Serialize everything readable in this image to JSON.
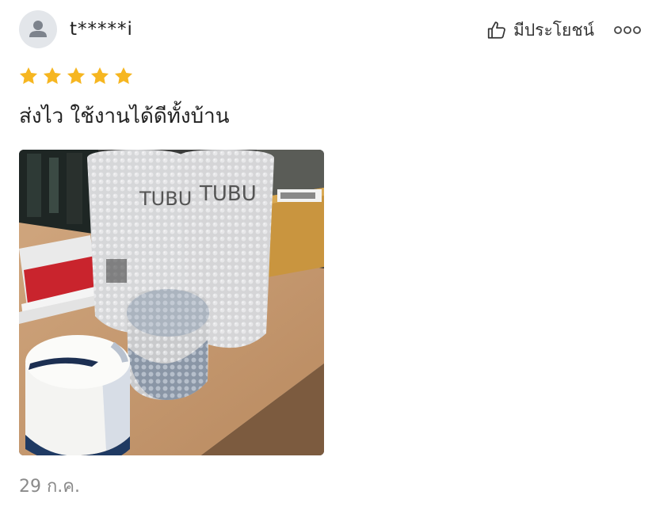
{
  "review": {
    "username": "t*****i",
    "rating": 5,
    "rating_max": 5,
    "text": "ส่งไว ใช้งานได้ดีทั้งบ้าน",
    "date": "29 ก.ค."
  },
  "actions": {
    "helpful_label": "มีประโยชน์",
    "helpful_icon": "thumbs-up-icon",
    "more_icon": "more-dots-icon"
  },
  "photo": {
    "bottle_brand": "TUBU"
  },
  "colors": {
    "star": "#F6B620",
    "avatar_bg": "#E3E6EA",
    "date_text": "#8A8A8A"
  }
}
